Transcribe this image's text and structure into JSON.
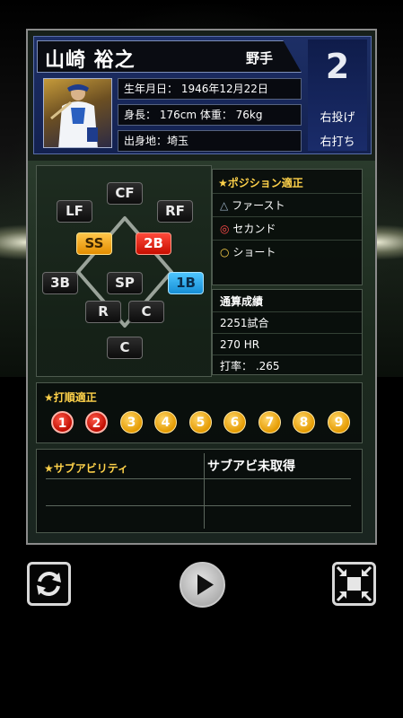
{
  "player": {
    "name": "山崎 裕之",
    "type": "野手",
    "number": "2",
    "throws": "右投げ",
    "bats": "右打ち",
    "birth": "生年月日： 1946年12月22日",
    "body": "身長： 176cm 体重： 76kg",
    "hometown": "出身地：埼玉"
  },
  "positions": {
    "cf": "CF",
    "lf": "LF",
    "rf": "RF",
    "ss": "SS",
    "second": "2B",
    "third": "3B",
    "sp": "SP",
    "first": "1B",
    "rp": "R",
    "cp": "C",
    "catcher": "C"
  },
  "aptitude": {
    "title": "★ポジション適正",
    "rows": [
      {
        "mark": "△",
        "label": "ファースト"
      },
      {
        "mark": "◎",
        "label": "セカンド"
      },
      {
        "mark": "○",
        "label": "ショート"
      }
    ]
  },
  "career": {
    "title": "通算成績",
    "games": "2251試合",
    "hr": "270 HR",
    "avg": "打率： .265"
  },
  "batting_order": {
    "title": "★打順適正",
    "items": [
      "1",
      "2",
      "3",
      "4",
      "5",
      "6",
      "7",
      "8",
      "9"
    ],
    "active": [
      1,
      2
    ]
  },
  "sub_ability": {
    "title": "★サブアビリティ",
    "value": "サブアビ未取得"
  },
  "colors": {
    "accent": "#ffd24a",
    "card_header": "#1d2f66",
    "active_order": "#c10c00",
    "order": "#e49a00"
  },
  "controls": {
    "rotate": "rotate-icon",
    "play": "play-icon",
    "shrink": "shrink-icon"
  }
}
